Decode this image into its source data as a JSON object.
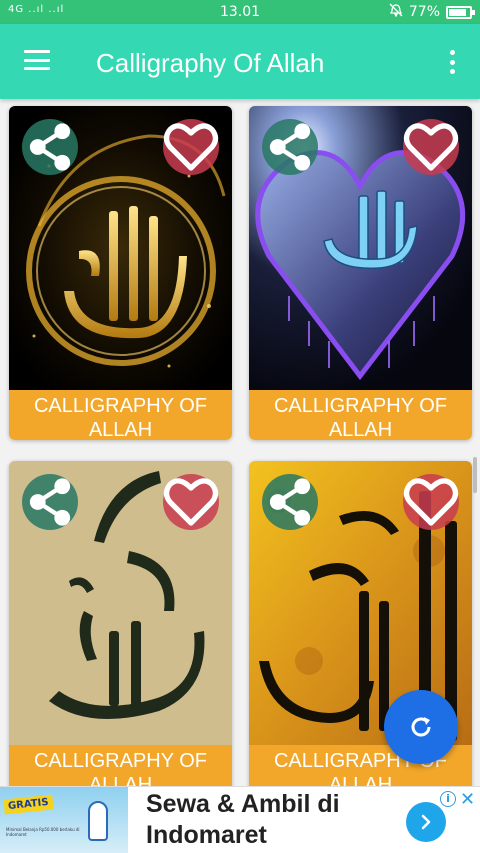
{
  "status_bar": {
    "network": "4G ..ıl ..ıl",
    "time": "13.01",
    "battery_percent": "77%",
    "battery_level": 0.77
  },
  "app_bar": {
    "title": "Calligraphy Of Allah",
    "menu_icon": "hamburger-menu-icon",
    "overflow_icon": "more-vert-icon"
  },
  "cards": [
    {
      "caption": "CALLIGRAPHY OF ALLAH",
      "share_icon": "share-icon",
      "favorite_icon": "heart-outline-icon"
    },
    {
      "caption": "CALLIGRAPHY OF ALLAH",
      "share_icon": "share-icon",
      "favorite_icon": "heart-outline-icon"
    },
    {
      "caption": "CALLIGRAPHY OF ALLAH",
      "share_icon": "share-icon",
      "favorite_icon": "heart-outline-icon"
    },
    {
      "caption": "CALLIGRAPHY OF ALLAH",
      "share_icon": "share-icon",
      "favorite_icon": "heart-outline-icon"
    }
  ],
  "fab": {
    "icon": "refresh-icon",
    "color": "#1e6fe6"
  },
  "ad": {
    "badge": "GRATIS",
    "fine_print": "Minimal Belanja Rp50.000 berlaku di Indomaret",
    "headline": "Sewa & Ambil di Indomaret",
    "info_icon": "i",
    "close_icon": "✕",
    "cta_icon": "chevron-right-icon"
  },
  "colors": {
    "status_bar": "#34c279",
    "app_bar": "#34d9b4",
    "caption_bg": "#f2a72a",
    "share_bg": "#287864",
    "favorite_bg": "#c83c50"
  }
}
